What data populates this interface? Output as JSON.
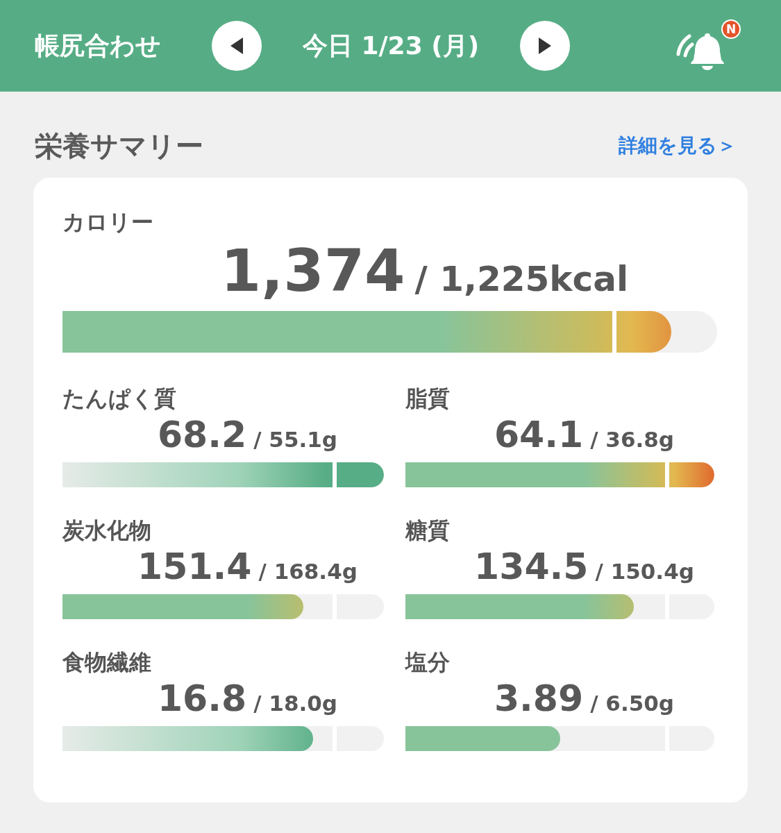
{
  "header": {
    "title": "帳尻合わせ",
    "date": "今日 1/23 (月)",
    "badge": "N"
  },
  "section": {
    "title": "栄養サマリー",
    "link": "詳細を見る＞"
  },
  "calorie": {
    "label": "カロリー",
    "value": "1,374",
    "target": "/ 1,225kcal",
    "level": 0.93,
    "kind": "warm"
  },
  "nutrients": [
    {
      "label": "たんぱく質",
      "value": "68.2",
      "target": "/ 55.1g",
      "level": 1,
      "kind": "cool"
    },
    {
      "label": "脂質",
      "value": "64.1",
      "target": "/ 36.8g",
      "level": 1,
      "kind": "warm"
    },
    {
      "label": "炭水化物",
      "value": "151.4",
      "target": "/ 168.4g",
      "level": 0.75,
      "kind": "warm"
    },
    {
      "label": "糖質",
      "value": "134.5",
      "target": "/ 150.4g",
      "level": 0.74,
      "kind": "warm"
    },
    {
      "label": "食物繊維",
      "value": "16.8",
      "target": "/ 18.0g",
      "level": 0.78,
      "kind": "cool"
    },
    {
      "label": "塩分",
      "value": "3.89",
      "target": "/ 6.50g",
      "level": 0.5,
      "kind": "warm"
    }
  ]
}
